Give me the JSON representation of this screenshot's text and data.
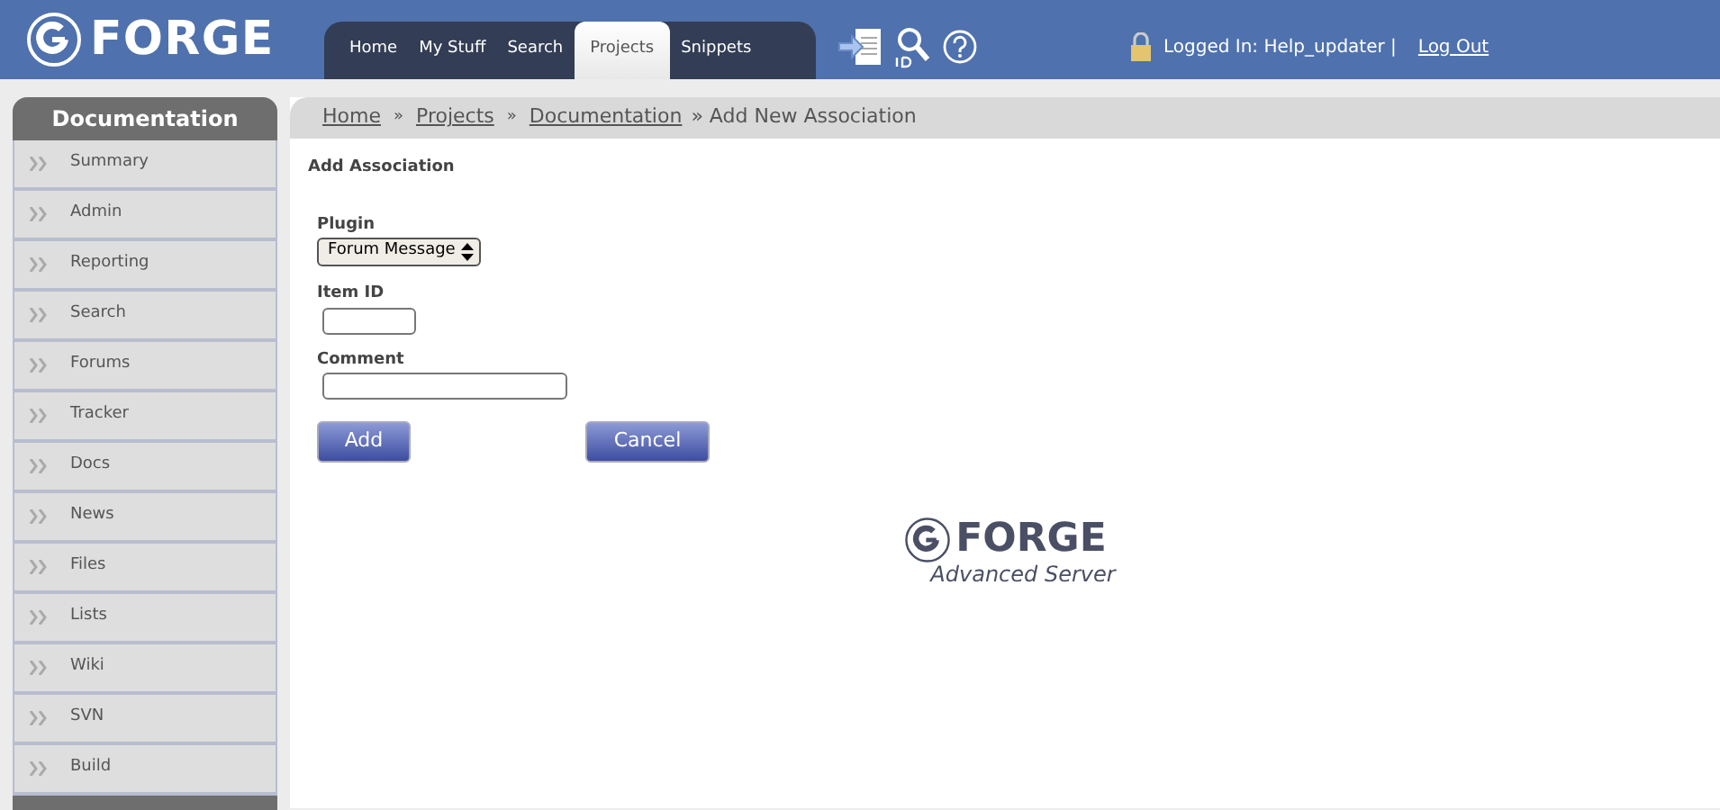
{
  "header": {
    "logo": "FORGE",
    "tabs": [
      {
        "label": "Home",
        "selected": false
      },
      {
        "label": "My Stuff",
        "selected": false
      },
      {
        "label": "Search",
        "selected": false
      },
      {
        "label": "Projects",
        "selected": true
      },
      {
        "label": "Snippets",
        "selected": false
      }
    ],
    "login_text": "Logged In: Help_updater |",
    "logout": "Log Out"
  },
  "sidebar": {
    "title": "Documentation",
    "items": [
      "Summary",
      "Admin",
      "Reporting",
      "Search",
      "Forums",
      "Tracker",
      "Docs",
      "News",
      "Files",
      "Lists",
      "Wiki",
      "SVN",
      "Build"
    ]
  },
  "breadcrumb": {
    "links": [
      "Home",
      "Projects",
      "Documentation"
    ],
    "separator": "»",
    "current": "» Add New Association"
  },
  "form": {
    "title": "Add Association",
    "plugin_label": "Plugin",
    "plugin_value": "Forum Message",
    "item_id_label": "Item ID",
    "comment_label": "Comment",
    "buttons": [
      "Add",
      "Cancel"
    ]
  },
  "footer_logo": {
    "name": "FORGE",
    "subtitle": "Advanced Server"
  }
}
